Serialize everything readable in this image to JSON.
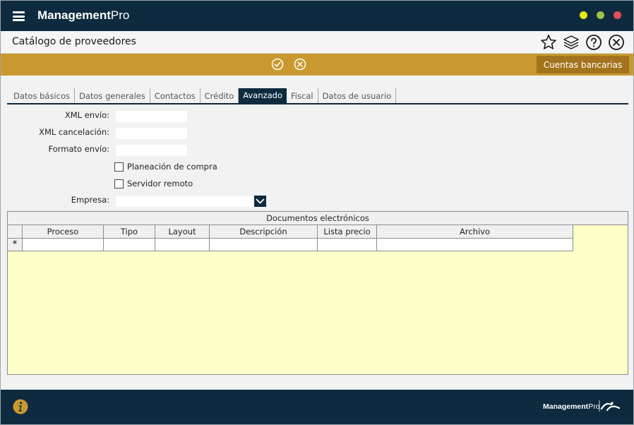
{
  "app": {
    "title_bold": "Management",
    "title_light": "Pro",
    "window_controls": [
      {
        "name": "minimize",
        "color": "#e6e619"
      },
      {
        "name": "maximize",
        "color": "#9cc34a"
      },
      {
        "name": "close",
        "color": "#e0505a"
      }
    ]
  },
  "header": {
    "page_title": "Catálogo de proveedores",
    "icons": [
      "star-icon",
      "layers-icon",
      "help-icon",
      "close-circle-icon"
    ]
  },
  "actionbar": {
    "icons": [
      "check-circle-icon",
      "cancel-circle-icon"
    ],
    "cuentas_label": "Cuentas bancarias"
  },
  "tabs": [
    {
      "label": "Datos básicos",
      "active": false
    },
    {
      "label": "Datos generales",
      "active": false
    },
    {
      "label": "Contactos",
      "active": false
    },
    {
      "label": "Crédito",
      "active": false
    },
    {
      "label": "Avanzado",
      "active": true
    },
    {
      "label": "Fiscal",
      "active": false
    },
    {
      "label": "Datos de usuario",
      "active": false
    }
  ],
  "form": {
    "xml_envio_label": "XML envío:",
    "xml_envio_value": "",
    "xml_cancelacion_label": "XML cancelación:",
    "xml_cancelacion_value": "",
    "formato_envio_label": "Formato envío:",
    "formato_envio_value": "",
    "planeacion_label": "Planeación de compra",
    "planeacion_checked": false,
    "servidor_label": "Servidor remoto",
    "servidor_checked": false,
    "empresa_label": "Empresa:",
    "empresa_value": ""
  },
  "grid": {
    "title": "Documentos electrónicos",
    "columns": [
      "Proceso",
      "Tipo",
      "Layout",
      "Descripción",
      "Lista precio",
      "Archivo"
    ],
    "new_row_marker": "*"
  },
  "footer": {
    "logo_bold": "Management",
    "logo_light": "Pro"
  },
  "colors": {
    "navy": "#0d2a3e",
    "gold": "#c9992f",
    "gold_dark": "#a3741d",
    "grid_bg": "#ffffc8"
  }
}
